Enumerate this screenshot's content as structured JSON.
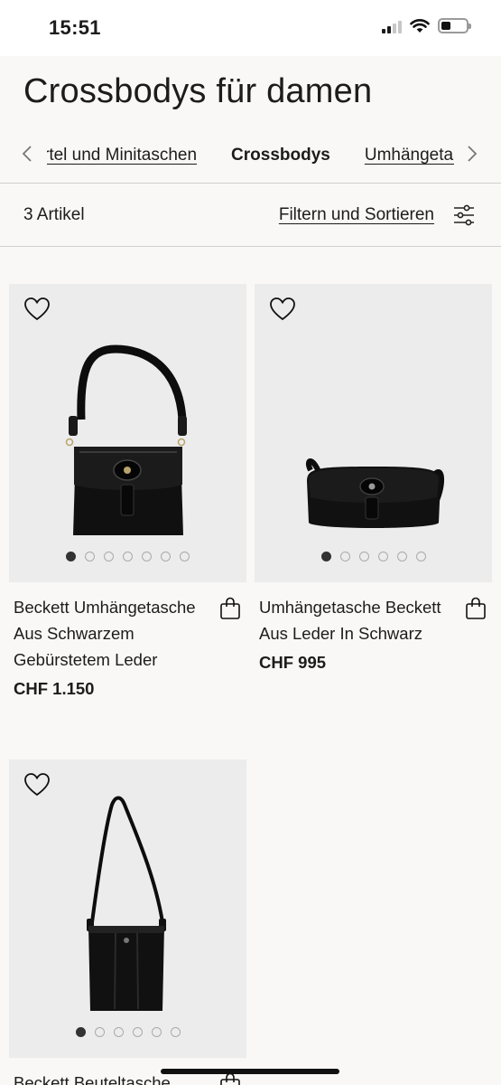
{
  "status_bar": {
    "time": "15:51"
  },
  "page": {
    "title": "Crossbodys für damen"
  },
  "categories": {
    "items": [
      {
        "label": "rtel und Minitaschen",
        "active": false
      },
      {
        "label": "Crossbodys",
        "active": true
      },
      {
        "label": "Umhängetaschen",
        "active": false
      }
    ]
  },
  "toolbar": {
    "count": "3 Artikel",
    "filter_label": "Filtern und Sortieren"
  },
  "products": [
    {
      "name": "Beckett Umhängetasche Aus Schwarzem Gebürstetem Leder",
      "price": "CHF 1.150",
      "image_count": 7,
      "active_image": 1
    },
    {
      "name": "Umhängetasche Beckett Aus Leder In Schwarz",
      "price": "CHF 995",
      "image_count": 6,
      "active_image": 1
    },
    {
      "name": "Beckett Beuteltasche",
      "price": "",
      "image_count": 6,
      "active_image": 1
    }
  ],
  "icons": {
    "wishlist": "heart-icon",
    "add_to_cart": "shopping-bag-icon",
    "filter": "sliders-icon",
    "prev": "chevron-left-icon",
    "next": "chevron-right-icon"
  }
}
